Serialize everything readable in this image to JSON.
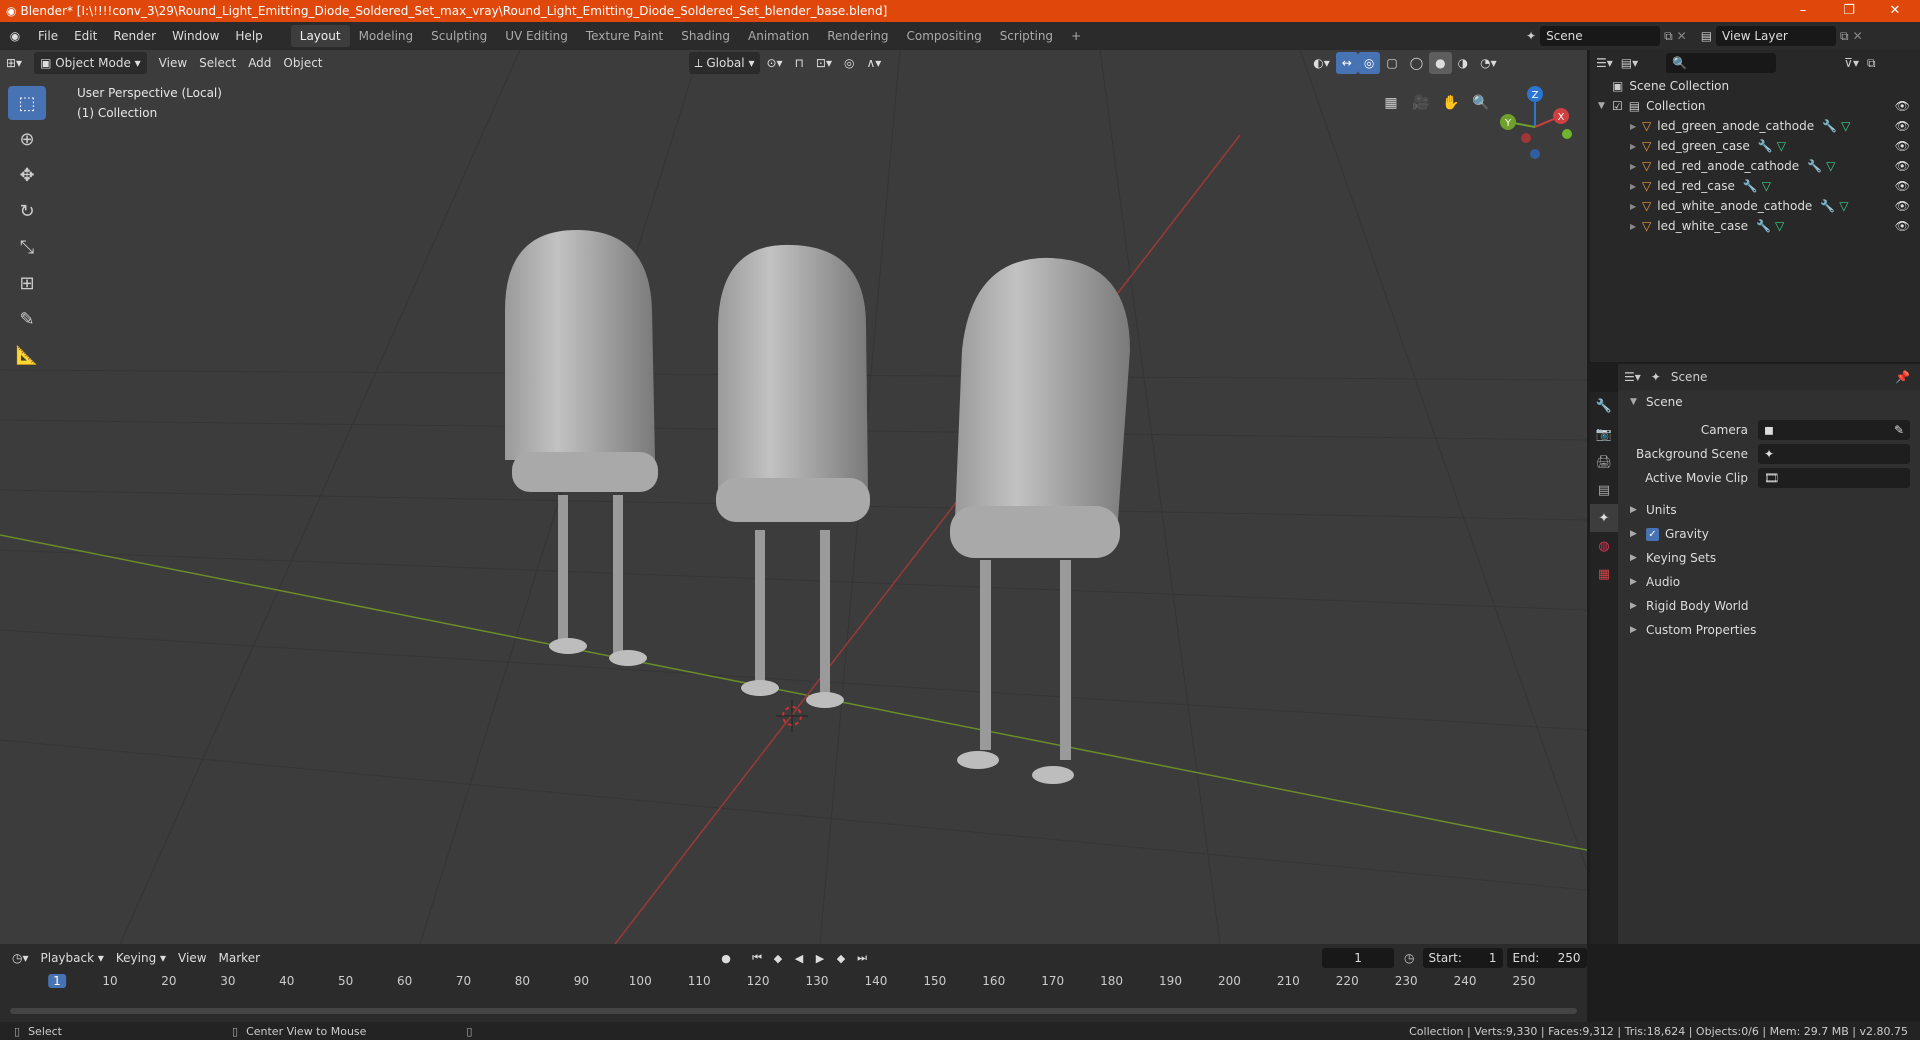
{
  "window": {
    "title": "Blender* [I:\\!!!!conv_3\\29\\Round_Light_Emitting_Diode_Soldered_Set_max_vray\\Round_Light_Emitting_Diode_Soldered_Set_blender_base.blend]",
    "minimize": "–",
    "maximize": "❐",
    "close": "✕"
  },
  "menus": [
    "File",
    "Edit",
    "Render",
    "Window",
    "Help"
  ],
  "workspaces": [
    "Layout",
    "Modeling",
    "Sculpting",
    "UV Editing",
    "Texture Paint",
    "Shading",
    "Animation",
    "Rendering",
    "Compositing",
    "Scripting"
  ],
  "active_workspace": "Layout",
  "add_workspace": "+",
  "scene_selector": "Scene",
  "view_layer": "View Layer",
  "viewport": {
    "mode": "Object Mode",
    "menus": [
      "View",
      "Select",
      "Add",
      "Object"
    ],
    "orientation": "Global",
    "info_line1": "User Perspective (Local)",
    "info_line2": "(1) Collection",
    "gizmo_labels": {
      "z": "Z",
      "y": "Y",
      "x": "X"
    }
  },
  "outliner": {
    "search_placeholder": "",
    "root": "Scene Collection",
    "collection": "Collection",
    "items": [
      {
        "name": "led_green_anode_cathode"
      },
      {
        "name": "led_green_case"
      },
      {
        "name": "led_red_anode_cathode"
      },
      {
        "name": "led_red_case"
      },
      {
        "name": "led_white_anode_cathode"
      },
      {
        "name": "led_white_case"
      }
    ]
  },
  "properties": {
    "header": "Scene",
    "section": "Scene",
    "rows": [
      {
        "label": "Camera"
      },
      {
        "label": "Background Scene"
      },
      {
        "label": "Active Movie Clip"
      }
    ],
    "panels": [
      "Units",
      "Gravity",
      "Keying Sets",
      "Audio",
      "Rigid Body World",
      "Custom Properties"
    ],
    "gravity_checked": true
  },
  "timeline": {
    "menus": [
      "Playback",
      "Keying",
      "View",
      "Marker"
    ],
    "current_frame": "1",
    "start_label": "Start:",
    "start": "1",
    "end_label": "End:",
    "end": "250",
    "ruler": [
      "1",
      "10",
      "20",
      "30",
      "40",
      "50",
      "60",
      "70",
      "80",
      "90",
      "100",
      "110",
      "120",
      "130",
      "140",
      "150",
      "160",
      "170",
      "180",
      "190",
      "200",
      "210",
      "220",
      "230",
      "240",
      "250"
    ]
  },
  "statusbar": {
    "select": "Select",
    "center": "Center View to Mouse",
    "stats": "Collection | Verts:9,330 | Faces:9,312 | Tris:18,624 | Objects:0/6 | Mem: 29.7 MB | v2.80.75"
  }
}
